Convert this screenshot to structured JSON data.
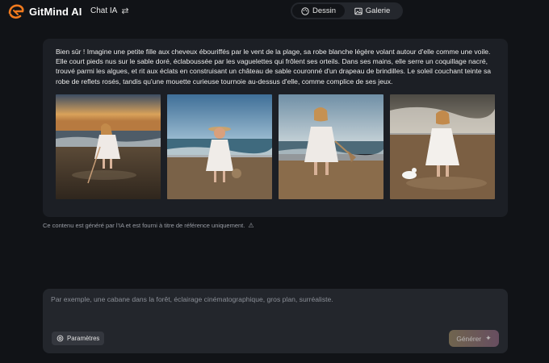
{
  "header": {
    "brand_name": "GitMind AI",
    "chat_label": "Chat IA",
    "chat_icon": "swap-icon",
    "modes": [
      {
        "label": "Dessin",
        "icon": "palette-icon",
        "active": true
      },
      {
        "label": "Galerie",
        "icon": "image-icon",
        "active": false
      }
    ]
  },
  "response": {
    "text": "Bien sûr ! Imagine une petite fille aux cheveux ébouriffés par le vent de la plage, sa robe blanche légère volant autour d'elle comme une voile. Elle court pieds nus sur le sable doré, éclaboussée par les vaguelettes qui frôlent ses orteils. Dans ses mains, elle serre un coquillage nacré, trouvé parmi les algues, et rit aux éclats en construisant un château de sable couronné d'un drapeau de brindilles. Le soleil couchant teinte sa robe de reflets rosés, tandis qu'une mouette curieuse tournoie au-dessus d'elle, comme complice de ses jeux.",
    "images": [
      "generated-image-1",
      "generated-image-2",
      "generated-image-3",
      "generated-image-4"
    ]
  },
  "disclaimer": {
    "text": "Ce contenu est généré par l'IA et est fourni à titre de référence uniquement.",
    "icon": "warning-icon"
  },
  "composer": {
    "placeholder": "Par exemple, une cabane dans la forêt, éclairage cinématographique, gros plan, surréaliste.",
    "value": "",
    "params_label": "Paramètres",
    "generate_label": "Générer"
  },
  "colors": {
    "background": "#111317",
    "card": "#1c1f25",
    "brand_orange": "#f07a1e"
  }
}
